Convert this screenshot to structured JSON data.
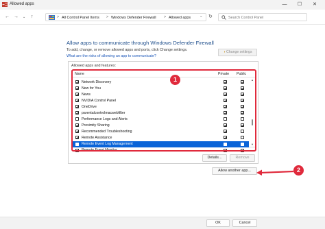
{
  "window": {
    "title": "Allowed apps",
    "minimize_glyph": "—",
    "maximize_glyph": "☐",
    "close_glyph": "✕"
  },
  "address": {
    "breadcrumb": [
      "All Control Panel Items",
      "Windows Defender Firewall",
      "Allowed apps"
    ],
    "separator": ">",
    "search_placeholder": "Search Control Panel"
  },
  "content": {
    "heading": "Allow apps to communicate through Windows Defender Firewall",
    "subtitle": "To add, change, or remove allowed apps and ports, click Change settings.",
    "risk_link": "What are the risks of allowing an app to communicate?",
    "change_settings_label": "Change settings",
    "group_label": "Allowed apps and features:",
    "columns": {
      "name": "Name",
      "private": "Private",
      "public": "Public"
    },
    "rows": [
      {
        "name": "Network Discovery",
        "enabled": true,
        "private": true,
        "public": true,
        "selected": false
      },
      {
        "name": "New for You",
        "enabled": true,
        "private": true,
        "public": true,
        "selected": false
      },
      {
        "name": "News",
        "enabled": true,
        "private": true,
        "public": true,
        "selected": false
      },
      {
        "name": "NVIDIA Control Panel",
        "enabled": true,
        "private": true,
        "public": true,
        "selected": false
      },
      {
        "name": "OneDrive",
        "enabled": true,
        "private": true,
        "public": true,
        "selected": false
      },
      {
        "name": "parentalcontrolmacwebfilter",
        "enabled": true,
        "private": true,
        "public": true,
        "selected": false
      },
      {
        "name": "Performance Logs and Alerts",
        "enabled": false,
        "private": false,
        "public": false,
        "selected": false
      },
      {
        "name": "Proximity Sharing",
        "enabled": true,
        "private": true,
        "public": true,
        "selected": false
      },
      {
        "name": "Recommended Troubleshooting",
        "enabled": true,
        "private": true,
        "public": false,
        "selected": false
      },
      {
        "name": "Remote Assistance",
        "enabled": true,
        "private": true,
        "public": false,
        "selected": false
      },
      {
        "name": "Remote Event Log Management",
        "enabled": false,
        "private": false,
        "public": false,
        "selected": true
      },
      {
        "name": "Remote Event Monitor",
        "enabled": false,
        "private": false,
        "public": false,
        "selected": false
      }
    ],
    "details_label": "Details...",
    "remove_label": "Remove",
    "allow_another_label": "Allow another app..."
  },
  "annotations": {
    "badge1": "1",
    "badge2": "2",
    "color": "#e02a3c"
  },
  "footer": {
    "ok_label": "OK",
    "cancel_label": "Cancel"
  },
  "colors": {
    "heading": "#1e4e8c",
    "link": "#1a56b8",
    "selection": "#0a64d8"
  }
}
